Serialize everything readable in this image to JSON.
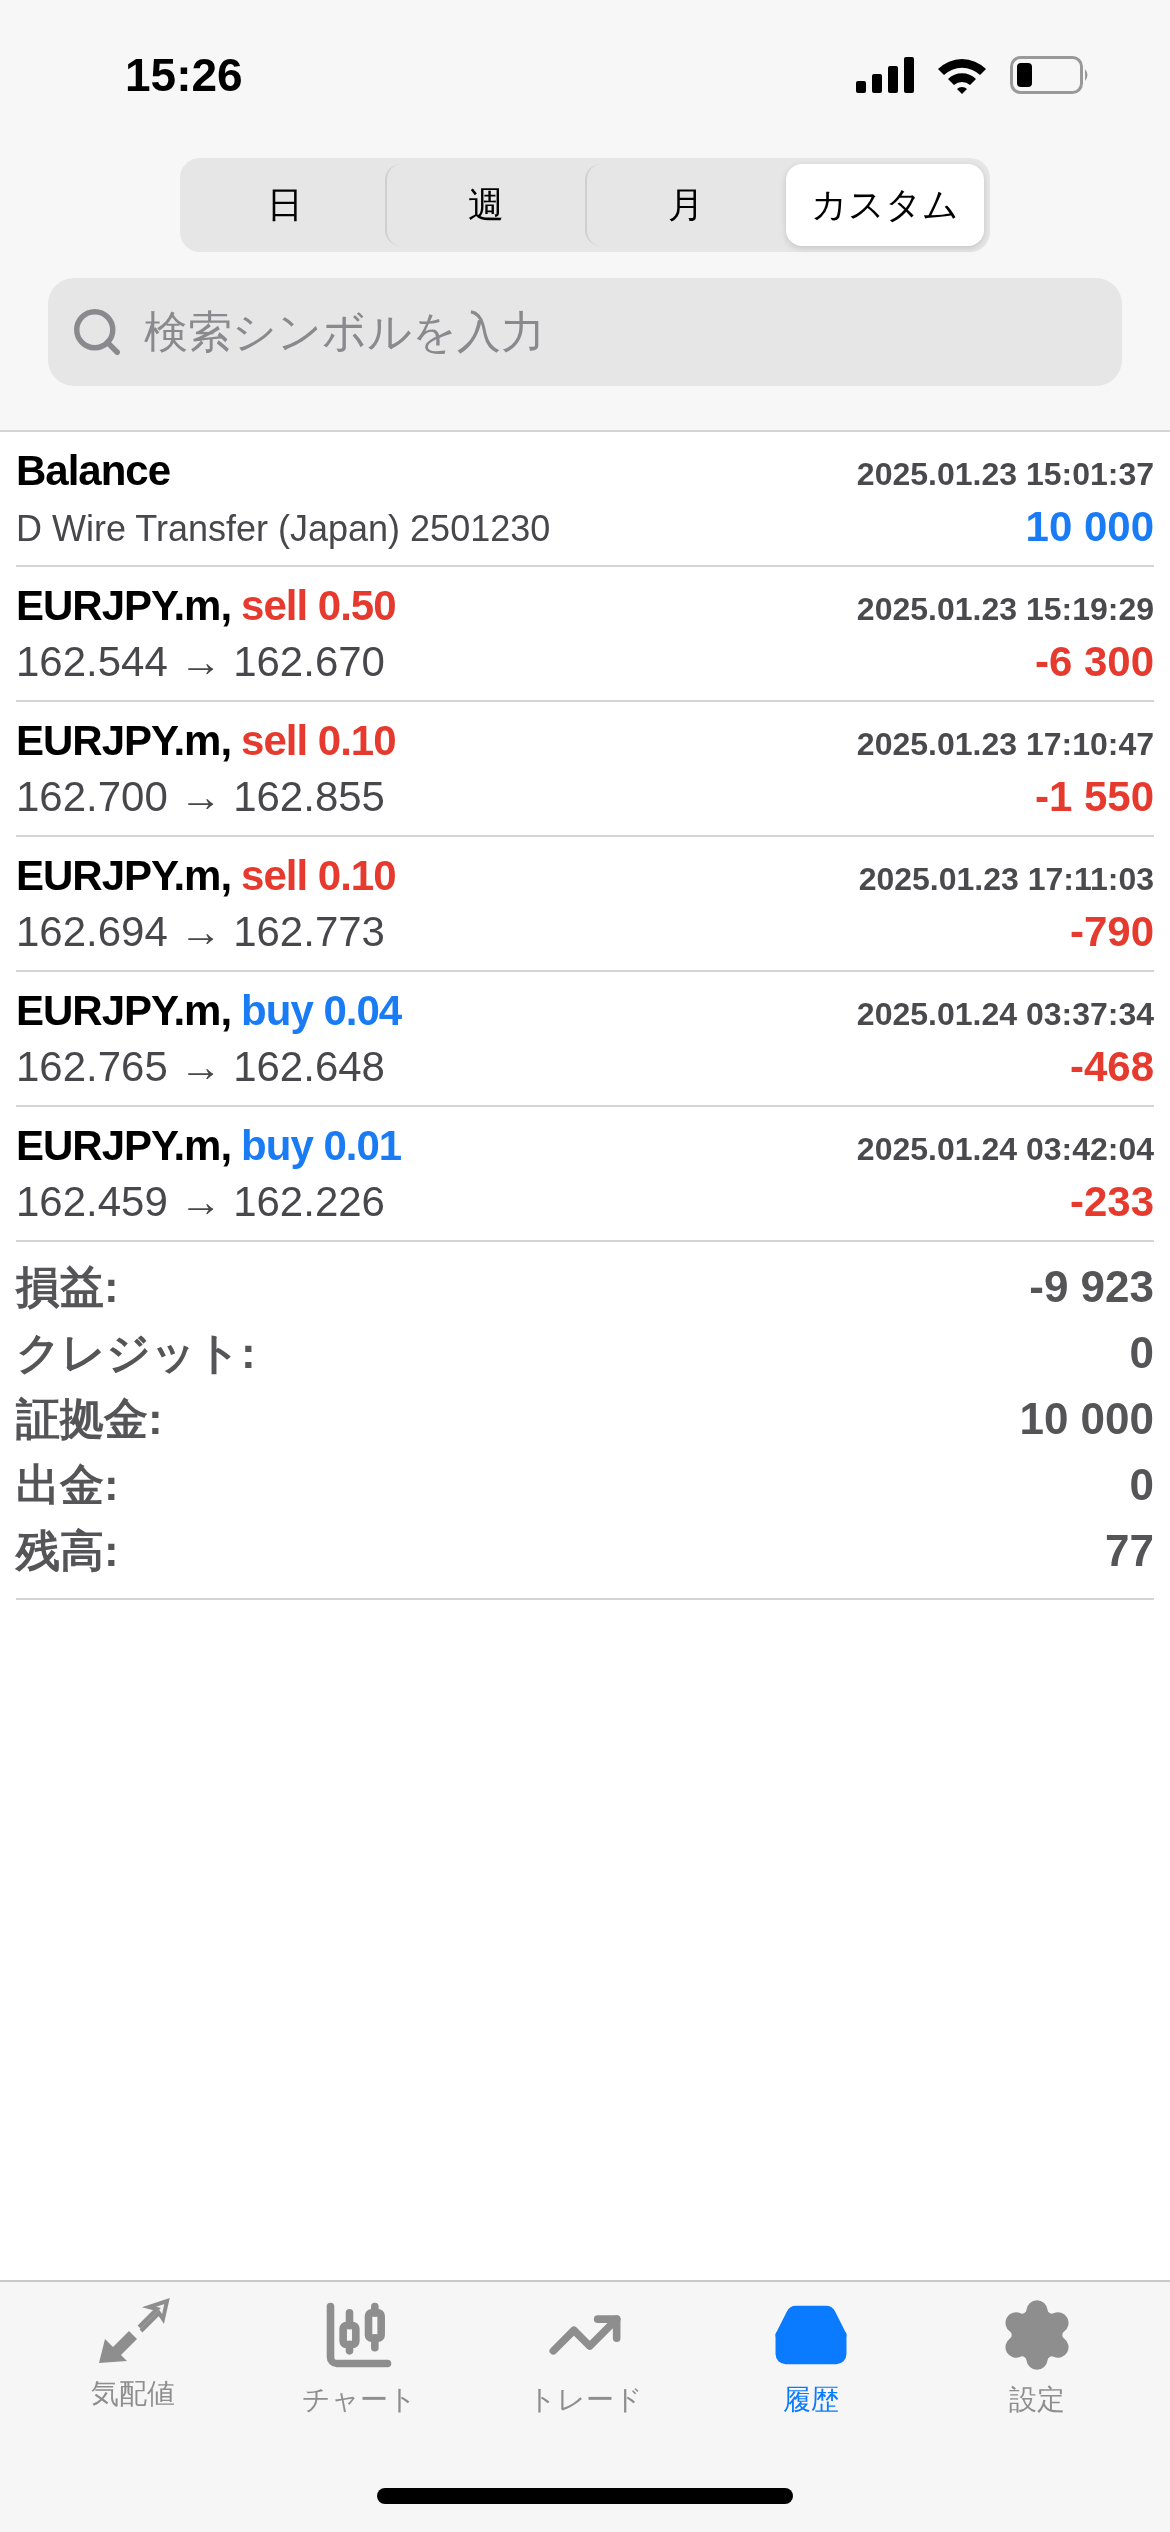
{
  "status_bar": {
    "time": "15:26"
  },
  "period_tabs": [
    {
      "label": "日",
      "selected": false
    },
    {
      "label": "週",
      "selected": false
    },
    {
      "label": "月",
      "selected": false
    },
    {
      "label": "カスタム",
      "selected": true
    }
  ],
  "search": {
    "placeholder": "検索シンボルを入力"
  },
  "history": [
    {
      "kind": "balance",
      "title": "Balance",
      "time": "2025.01.23 15:01:37",
      "detail": "D Wire Transfer (Japan) 2501230",
      "amount": "10 000",
      "color": "#1a7cf5"
    },
    {
      "kind": "trade",
      "title": "EURJPY.m,",
      "order": {
        "color": "#e53a2d",
        "text": "sell 0.50"
      },
      "time": "2025.01.23 15:19:29",
      "detail": "162.544 → 162.670",
      "amount": "-6 300",
      "color": "#e53a2d"
    },
    {
      "kind": "trade",
      "title": "EURJPY.m,",
      "order": {
        "color": "#e53a2d",
        "text": "sell 0.10"
      },
      "time": "2025.01.23 17:10:47",
      "detail": "162.700 → 162.855",
      "amount": "-1 550",
      "color": "#e53a2d"
    },
    {
      "kind": "trade",
      "title": "EURJPY.m,",
      "order": {
        "color": "#e53a2d",
        "text": "sell 0.10"
      },
      "time": "2025.01.23 17:11:03",
      "detail": "162.694 → 162.773",
      "amount": "-790",
      "color": "#e53a2d"
    },
    {
      "kind": "trade",
      "title": "EURJPY.m,",
      "order": {
        "color": "#1a7cf5",
        "text": "buy 0.04"
      },
      "time": "2025.01.24 03:37:34",
      "detail": "162.765 → 162.648",
      "amount": "-468",
      "color": "#e53a2d"
    },
    {
      "kind": "trade",
      "title": "EURJPY.m,",
      "order": {
        "color": "#1a7cf5",
        "text": "buy 0.01"
      },
      "time": "2025.01.24 03:42:04",
      "detail": "162.459 → 162.226",
      "amount": "-233",
      "color": "#e53a2d"
    }
  ],
  "summary": [
    {
      "label": "損益:",
      "value": "-9 923"
    },
    {
      "label": "クレジット:",
      "value": "0"
    },
    {
      "label": "証拠金:",
      "value": "10 000"
    },
    {
      "label": "出金:",
      "value": "0"
    },
    {
      "label": "残高:",
      "value": "77"
    }
  ],
  "bottom_nav": [
    {
      "kind": "quotes",
      "label": "気配値",
      "selected": false
    },
    {
      "kind": "chart",
      "label": "チャート",
      "selected": false
    },
    {
      "kind": "trade",
      "label": "トレード",
      "selected": false
    },
    {
      "kind": "history",
      "label": "履歴",
      "selected": true
    },
    {
      "kind": "settings",
      "label": "設定",
      "selected": false
    }
  ]
}
